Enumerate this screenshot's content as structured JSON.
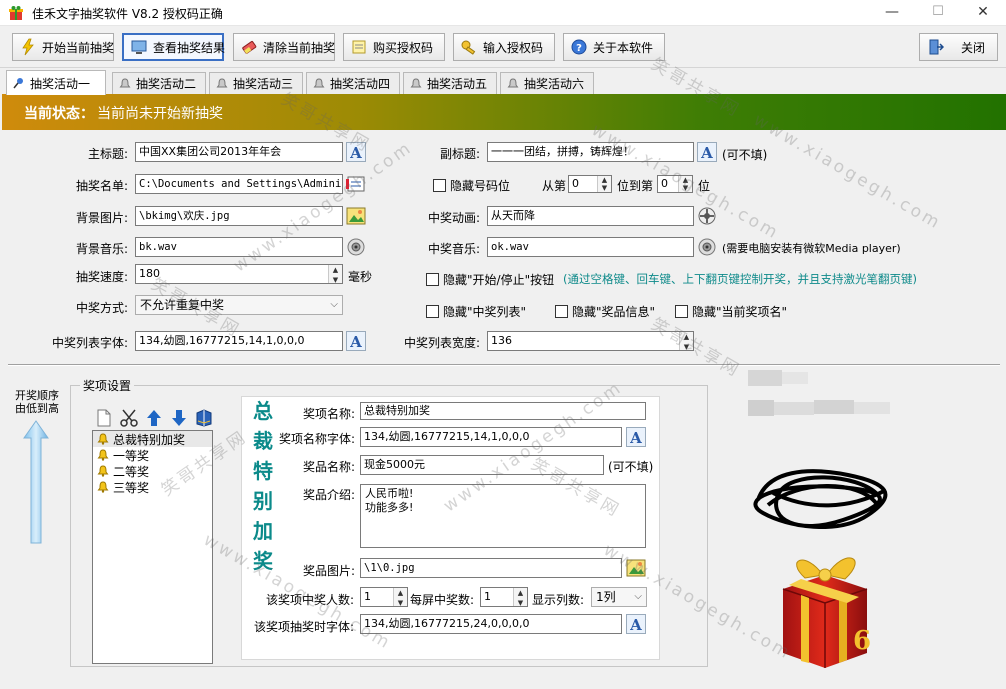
{
  "window": {
    "title": "佳禾文字抽奖软件 V8.2 授权码正确",
    "min": "—",
    "max": "☐",
    "close": "✕"
  },
  "toolbar": {
    "start": "开始当前抽奖",
    "view_results": "查看抽奖结果",
    "clear": "清除当前抽奖",
    "buy_license": "购买授权码",
    "enter_license": "输入授权码",
    "about": "关于本软件",
    "close": "关闭"
  },
  "tabs": [
    "抽奖活动一",
    "抽奖活动二",
    "抽奖活动三",
    "抽奖活动四",
    "抽奖活动五",
    "抽奖活动六"
  ],
  "status": {
    "label": "当前状态：",
    "value": "当前尚未开始新抽奖"
  },
  "form": {
    "main_title_label": "主标题:",
    "main_title": "中国XX集团公司2013年年会",
    "subtitle_label": "副标题:",
    "subtitle": "一一一团结，拼搏，铸辉煌！",
    "optional": "(可不填)",
    "list_label": "抽奖名单:",
    "list_path": "C:\\Documents and Settings\\Administ",
    "hide_digits_label": "隐藏号码位",
    "from_label": "从第",
    "from_value": "0",
    "to_label": "位到第",
    "to_value": "0",
    "pos_label": "位",
    "bg_image_label": "背景图片:",
    "bg_image": "\\bkimg\\欢庆.jpg",
    "win_anim_label": "中奖动画:",
    "win_anim": "从天而降",
    "bg_music_label": "背景音乐:",
    "bg_music": "bk.wav",
    "win_music_label": "中奖音乐:",
    "win_music": "ok.wav",
    "media_note": "(需要电脑安装有微软Media player)",
    "speed_label": "抽奖速度:",
    "speed": "180",
    "ms": "毫秒",
    "hide_startstop_label": "隐藏\"开始/停止\"按钮",
    "hide_startstop_note": "(通过空格键、回车键、上下翻页键控制开奖，并且支持激光笔翻页键)",
    "mode_label": "中奖方式:",
    "mode": "不允许重复中奖",
    "hide_winlist_label": "隐藏\"中奖列表\"",
    "hide_prizeinfo_label": "隐藏\"奖品信息\"",
    "hide_curprize_label": "隐藏\"当前奖项名\"",
    "font_label": "中奖列表字体:",
    "font": "134,幼圆,16777215,14,1,0,0,0",
    "width_label": "中奖列表宽度:",
    "width": "136"
  },
  "order": {
    "line1": "开奖顺序",
    "line2": "由低到高"
  },
  "prizes": {
    "group_title": "奖项设置",
    "items": [
      "总裁特别加奖",
      "一等奖",
      "二等奖",
      "三等奖"
    ],
    "vertical_title": [
      "总",
      "裁",
      "特",
      "别",
      "加",
      "奖"
    ],
    "name_label": "奖项名称:",
    "name": "总裁特别加奖",
    "name_font_label": "奖项名称字体:",
    "name_font": "134,幼圆,16777215,14,1,0,0,0",
    "item_name_label": "奖品名称:",
    "item_name": "现金5000元",
    "item_optional": "(可不填)",
    "intro_label": "奖品介绍:",
    "intro": "人民币啦!\n功能多多!",
    "image_label": "奖品图片:",
    "image": "\\1\\0.jpg",
    "count_label": "该奖项中奖人数:",
    "count": "1",
    "per_screen_label": "每屏中奖数:",
    "per_screen": "1",
    "columns_label": "显示列数:",
    "columns": "1列",
    "draw_font_label": "该奖项抽奖时字体:",
    "draw_font": "134,幼圆,16777215,24,0,0,0,0"
  },
  "watermark": {
    "text1": "笑哥共享网",
    "text2": "www.xiaogegh.com"
  },
  "colors": {
    "accent": "#3a6fc4",
    "status_start": "#cf8b0c",
    "status_end": "#227200",
    "teal": "#0e8a8a"
  }
}
